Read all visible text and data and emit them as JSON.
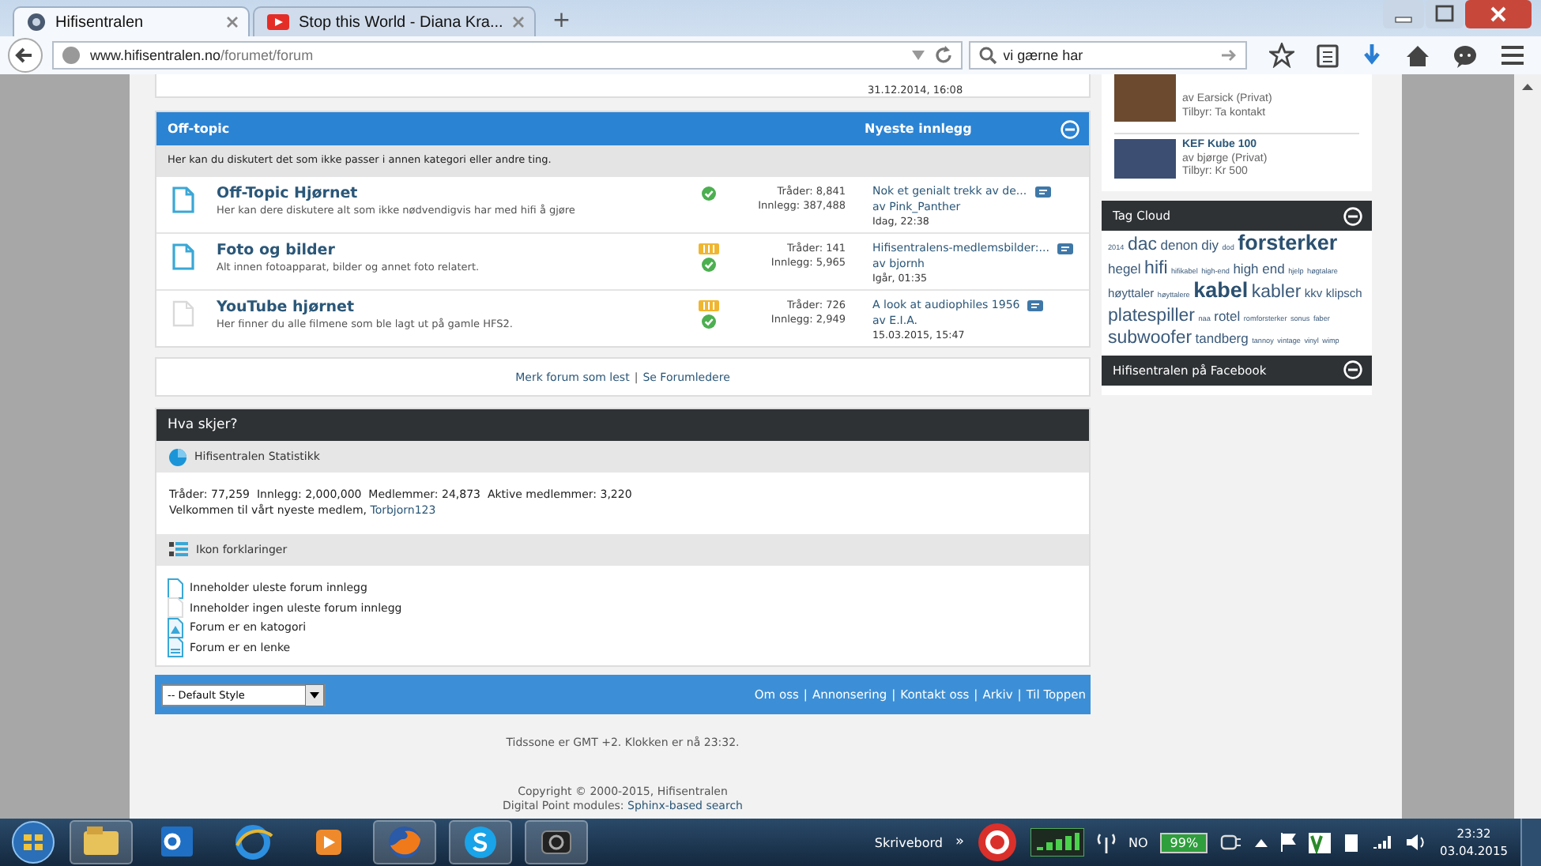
{
  "browser": {
    "tabs": [
      {
        "title": "Hifisentralen",
        "selected": true,
        "kind": "site"
      },
      {
        "title": "Stop this World - Diana Kra...",
        "selected": false,
        "kind": "video"
      }
    ],
    "new_tab": "+",
    "url": {
      "host": "www.hifisentralen.no",
      "path": "/forumet/forum"
    },
    "search": {
      "value": "vi gærne har"
    }
  },
  "top_fragment": {
    "time": "31.12.2014, 16:08"
  },
  "category": {
    "title": "Off-topic",
    "latest_heading": "Nyeste innlegg",
    "description": "Her kan du diskutert det som ikke passer i annen kategori eller andre ting.",
    "forums": [
      {
        "title": "Off-Topic Hjørnet",
        "description": "Her kan dere diskutere alt som ikke nødvendigvis har med hifi å gjøre",
        "unread": true,
        "feed": false,
        "threads": "Tråder: 8,841",
        "posts": "Innlegg: 387,488",
        "latest_title": "Nok et genialt trekk av de...",
        "latest_by": "av Pink_Panther",
        "latest_time": "Idag, 22:38"
      },
      {
        "title": "Foto og bilder",
        "description": "Alt innen fotoapparat, bilder og annet foto relatert.",
        "unread": true,
        "feed": true,
        "threads": "Tråder: 141",
        "posts": "Innlegg: 5,965",
        "latest_title": "Hifisentralens-medlemsbilder:...",
        "latest_by": "av bjornh",
        "latest_time": "Igår, 01:35"
      },
      {
        "title": "YouTube hjørnet",
        "description": "Her finner du alle filmene som ble lagt ut på gamle HFS2.",
        "unread": false,
        "feed": true,
        "threads": "Tråder: 726",
        "posts": "Innlegg: 2,949",
        "latest_title": "A look at audiophiles 1956",
        "latest_by": "av E.I.A.",
        "latest_time": "15.03.2015, 15:47"
      }
    ]
  },
  "forum_links": {
    "items": [
      "Merk forum som lest",
      "Se Forumledere"
    ],
    "separator": "|"
  },
  "whats_going_on": {
    "title": "Hva skjer?",
    "stats_heading": "Hifisentralen Statistikk",
    "stats_line": "Tråder: 77,259  Innlegg: 2,000,000  Medlemmer: 24,873  Aktive medlemmer: 3,220",
    "welcome": "Velkommen til vårt nyeste medlem,",
    "newest_member": "Torbjorn123",
    "legend_heading": "Ikon forklaringer",
    "legend": [
      {
        "kind": "unread",
        "text": "Inneholder uleste forum innlegg"
      },
      {
        "kind": "read",
        "text": "Inneholder ingen uleste forum innlegg"
      },
      {
        "kind": "category",
        "text": "Forum er en katogori"
      },
      {
        "kind": "link",
        "text": "Forum er en lenke"
      }
    ]
  },
  "footer": {
    "style_select": "-- Default Style",
    "links": [
      "Om oss",
      "Annonsering",
      "Kontakt oss",
      "Arkiv",
      "Til Toppen"
    ],
    "separator": "|",
    "timezone": "Tidssone er GMT +2. Klokken er nå 23:32.",
    "copyright": "Copyright © 2000-2015, Hifisentralen",
    "modules": "Digital Point modules:",
    "modules_link": "Sphinx-based search"
  },
  "sidebar": {
    "classifieds": [
      {
        "by": "av Earsick (Privat)",
        "offer": "Tilbyr: Ta kontakt"
      },
      {
        "title": "KEF Kube 100",
        "by": "av bjørge (Privat)",
        "offer": "Tilbyr: Kr 500"
      }
    ],
    "tag_cloud": {
      "title": "Tag Cloud",
      "tags": [
        {
          "text": "2014",
          "kind": "tiny"
        },
        {
          "text": "dac",
          "kind": "large"
        },
        {
          "text": "denon",
          "kind": "medium"
        },
        {
          "text": "diy",
          "kind": "medium"
        },
        {
          "text": "dod",
          "kind": "tiny"
        },
        {
          "text": "forsterker",
          "kind": "huge"
        },
        {
          "text": "hegel",
          "kind": "medium"
        },
        {
          "text": "hifi",
          "kind": "large"
        },
        {
          "text": "hifikabel",
          "kind": "tiny"
        },
        {
          "text": "high-end",
          "kind": "tiny"
        },
        {
          "text": "high end",
          "kind": "medium"
        },
        {
          "text": "hjelp",
          "kind": "tiny"
        },
        {
          "text": "høgtalare",
          "kind": "tiny"
        },
        {
          "text": "høyttaler",
          "kind": "small"
        },
        {
          "text": "høyttalere",
          "kind": "tiny"
        },
        {
          "text": "kabel",
          "kind": "huge"
        },
        {
          "text": "kabler",
          "kind": "large"
        },
        {
          "text": "kkv",
          "kind": "small"
        },
        {
          "text": "klipsch",
          "kind": "small"
        },
        {
          "text": "platespiller",
          "kind": "large"
        },
        {
          "text": "naa",
          "kind": "tiny"
        },
        {
          "text": "rotel",
          "kind": "medium"
        },
        {
          "text": "romforsterker",
          "kind": "tiny"
        },
        {
          "text": "sonus",
          "kind": "tiny"
        },
        {
          "text": "faber",
          "kind": "tiny"
        },
        {
          "text": "subwoofer",
          "kind": "large"
        },
        {
          "text": "tandberg",
          "kind": "medium"
        },
        {
          "text": "tannoy",
          "kind": "tiny"
        },
        {
          "text": "vintage",
          "kind": "tiny"
        },
        {
          "text": "vinyl",
          "kind": "tiny"
        },
        {
          "text": "wimp",
          "kind": "tiny"
        }
      ]
    },
    "facebook": {
      "title": "Hifisentralen på Facebook"
    }
  },
  "taskbar": {
    "apps": [
      {
        "kind": "explorer",
        "running": true
      },
      {
        "kind": "outlook",
        "running": false
      },
      {
        "kind": "ie",
        "running": false
      },
      {
        "kind": "media",
        "running": false
      },
      {
        "kind": "firefox",
        "running": true
      },
      {
        "kind": "skype",
        "running": true
      },
      {
        "kind": "camera",
        "running": true
      }
    ],
    "desktop": "Skrivebord",
    "desktop_arrow": "»",
    "language": "NO",
    "battery": "99%",
    "time": "23:32",
    "date": "03.04.2015"
  }
}
